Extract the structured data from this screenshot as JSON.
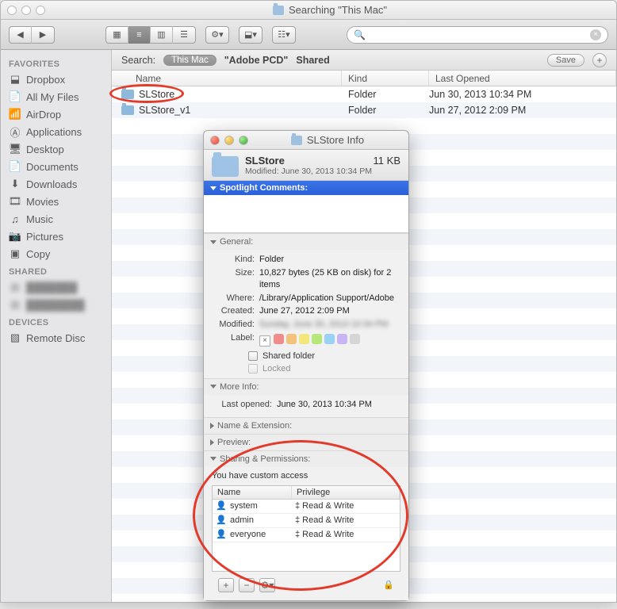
{
  "window": {
    "title": "Searching \"This Mac\""
  },
  "toolbar": {
    "search_placeholder": ""
  },
  "search_row": {
    "label": "Search:",
    "scope_current": "This Mac",
    "scope_other": "\"Adobe PCD\"",
    "scope_shared": "Shared",
    "save": "Save"
  },
  "columns": {
    "name": "Name",
    "kind": "Kind",
    "last": "Last Opened"
  },
  "results": [
    {
      "name": "SLStore",
      "kind": "Folder",
      "last": "Jun 30, 2013 10:34 PM"
    },
    {
      "name": "SLStore_v1",
      "kind": "Folder",
      "last": "Jun 27, 2012 2:09 PM"
    }
  ],
  "sidebar": {
    "favorites_head": "FAVORITES",
    "favorites": [
      "Dropbox",
      "All My Files",
      "AirDrop",
      "Applications",
      "Desktop",
      "Documents",
      "Downloads",
      "Movies",
      "Music",
      "Pictures",
      "Copy"
    ],
    "shared_head": "SHARED",
    "shared": [
      "███████",
      "████████"
    ],
    "devices_head": "DEVICES",
    "devices": [
      "Remote Disc"
    ]
  },
  "info": {
    "title": "SLStore Info",
    "name": "SLStore",
    "size_summary": "11 KB",
    "modified_line": "Modified: June 30, 2013 10:34 PM",
    "sections": {
      "spotlight": "Spotlight Comments:",
      "general": "General:",
      "more": "More Info:",
      "nameext": "Name & Extension:",
      "preview": "Preview:",
      "sharing": "Sharing & Permissions:"
    },
    "general": {
      "kind_k": "Kind:",
      "kind_v": "Folder",
      "size_k": "Size:",
      "size_v": "10,827 bytes (25 KB on disk) for 2 items",
      "where_k": "Where:",
      "where_v": "/Library/Application Support/Adobe",
      "created_k": "Created:",
      "created_v": "June 27, 2012 2:09 PM",
      "modified_k": "Modified:",
      "modified_v": "Sunday, June 30, 2013 10:34 PM",
      "label_k": "Label:",
      "shared_cb": "Shared folder",
      "locked_cb": "Locked"
    },
    "more_info": {
      "lastopened_k": "Last opened:",
      "lastopened_v": "June 30, 2013 10:34 PM"
    },
    "sharing": {
      "note": "You have custom access",
      "col_name": "Name",
      "col_priv": "Privilege",
      "rows": [
        {
          "name": "system",
          "priv": "Read & Write"
        },
        {
          "name": "admin",
          "priv": "Read & Write"
        },
        {
          "name": "everyone",
          "priv": "Read & Write"
        }
      ]
    },
    "label_colors": [
      "#f08c8c",
      "#f4c27a",
      "#f4e77a",
      "#b5e77a",
      "#9ad2f4",
      "#c9b5f4",
      "#d5d5d5"
    ]
  }
}
